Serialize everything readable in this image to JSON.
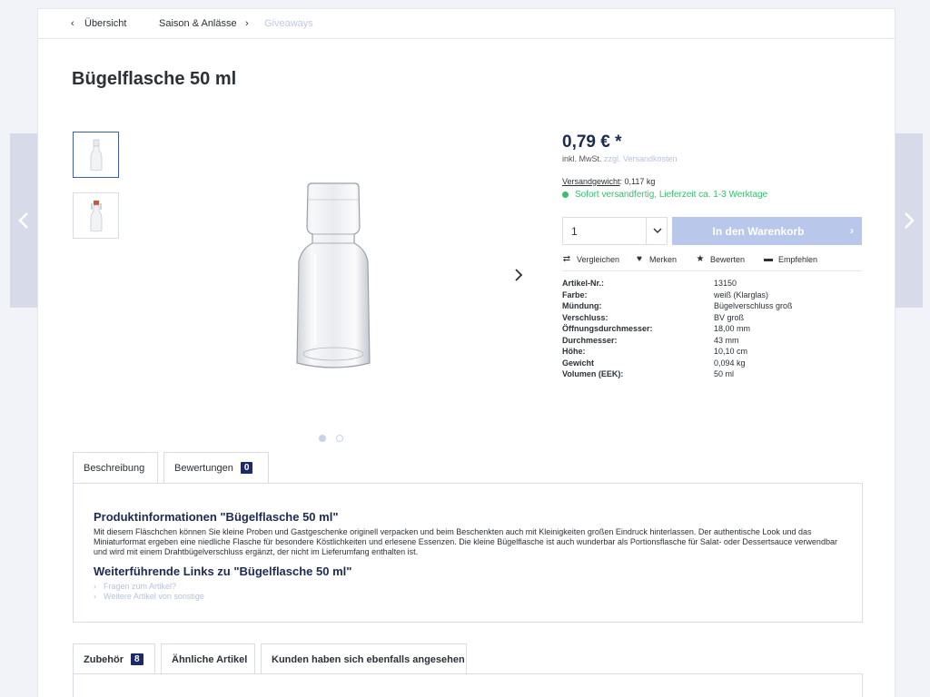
{
  "breadcrumb": {
    "items": [
      {
        "label": "Übersicht"
      },
      {
        "label": "Saison & Anlässe"
      },
      {
        "label": "Giveaways"
      }
    ]
  },
  "product": {
    "title": "Bügelflasche 50 ml",
    "price": "0,79 € *",
    "price_note": "inkl. MwSt.",
    "shipping_link": "zzgl. Versandkosten",
    "weight_label": "Versandgewicht",
    "weight_value": ": 0,117 kg",
    "availability": "Sofort versandfertig, Lieferzeit ca. 1-3 Werktage",
    "quantity": "1",
    "cart_button": "In den Warenkorb"
  },
  "actions": [
    {
      "label": "Vergleichen",
      "icon": "compare-icon"
    },
    {
      "label": "Merken",
      "icon": "heart-icon"
    },
    {
      "label": "Bewerten",
      "icon": "star-icon"
    },
    {
      "label": "Empfehlen",
      "icon": "comment-icon"
    }
  ],
  "properties": [
    {
      "label": "Artikel-Nr.:",
      "value": "13150"
    },
    {
      "label": "Farbe:",
      "value": "weiß (Klarglas)"
    },
    {
      "label": "Mündung:",
      "value": "Bügelverschluss groß"
    },
    {
      "label": "Verschluss:",
      "value": "BV groß"
    },
    {
      "label": "Öffnungsdurchmesser:",
      "value": "18,00 mm"
    },
    {
      "label": "Durchmesser:",
      "value": "43 mm"
    },
    {
      "label": "Höhe:",
      "value": "10,10 cm"
    },
    {
      "label": "Gewicht",
      "value": "0,094 kg"
    },
    {
      "label": "Volumen (EEK):",
      "value": "50 ml"
    }
  ],
  "tabs": {
    "description": "Beschreibung",
    "reviews": "Bewertungen",
    "reviews_count": "0"
  },
  "description": {
    "heading": "Produktinformationen \"Bügelflasche 50 ml\"",
    "text": "Mit diesem Fläschchen können Sie kleine Proben und Gastgeschenke originell verpacken und beim Beschenkten auch mit Kleinigkeiten großen Eindruck hinterlassen. Der authentische Look und das Miniaturformat ergeben eine niedliche Flasche für besondere Köstlichkeiten und erlesene Essenzen. Die kleine Bügelflasche ist auch wunderbar als Portionsflasche für Salat- oder Dessertsauce verwendbar und wird mit einem Drahtbügelverschluss ergänzt, der nicht im Lieferumfang enthalten ist.",
    "links_heading": "Weiterführende Links zu \"Bügelflasche 50 ml\"",
    "links": [
      "Fragen zum Artikel?",
      "Weitere Artikel von sonstige"
    ]
  },
  "bottom_tabs": {
    "accessories": "Zubehör",
    "accessories_count": "8",
    "similar": "Ähnliche Artikel",
    "also_viewed": "Kunden haben sich ebenfalls angesehen"
  },
  "colors": {
    "accent": "#1c2a6a",
    "available": "#33c06f",
    "button": "#b9c8ea",
    "link": "#b6c2dc"
  }
}
